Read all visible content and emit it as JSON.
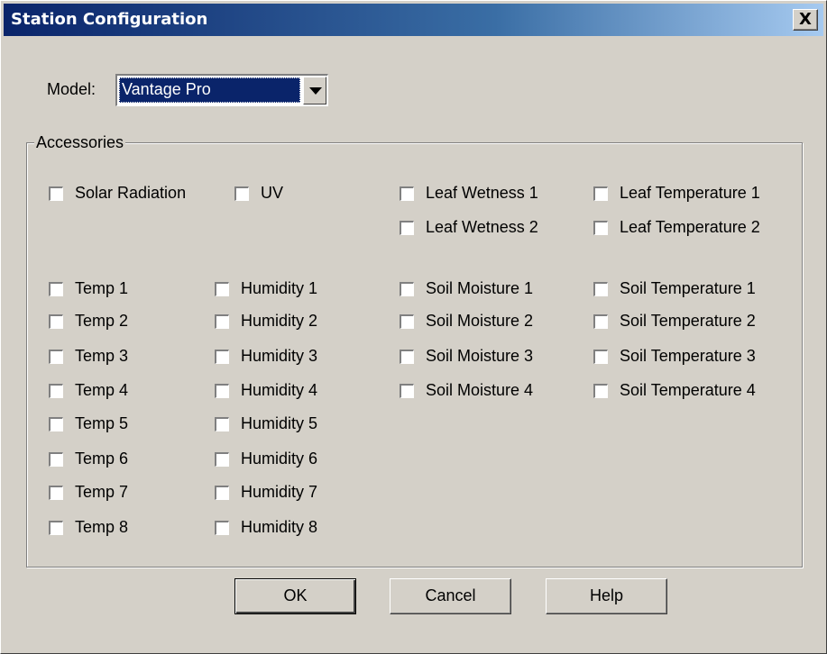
{
  "window": {
    "title": "Station Configuration",
    "close_label": "X"
  },
  "model": {
    "label": "Model:",
    "value": "Vantage Pro"
  },
  "accessories": {
    "group_label": "Accessories",
    "items": [
      {
        "id": "solar",
        "label": "Solar Radiation",
        "checked": false
      },
      {
        "id": "uv",
        "label": "UV",
        "checked": false
      },
      {
        "id": "leafwet1",
        "label": "Leaf Wetness 1",
        "checked": false
      },
      {
        "id": "leaftemp1",
        "label": "Leaf Temperature 1",
        "checked": false
      },
      {
        "id": "leafwet2",
        "label": "Leaf Wetness 2",
        "checked": false
      },
      {
        "id": "leaftemp2",
        "label": "Leaf Temperature 2",
        "checked": false
      },
      {
        "id": "temp1",
        "label": "Temp 1",
        "checked": false
      },
      {
        "id": "temp2",
        "label": "Temp 2",
        "checked": false
      },
      {
        "id": "temp3",
        "label": "Temp 3",
        "checked": false
      },
      {
        "id": "temp4",
        "label": "Temp 4",
        "checked": false
      },
      {
        "id": "temp5",
        "label": "Temp 5",
        "checked": false
      },
      {
        "id": "temp6",
        "label": "Temp 6",
        "checked": false
      },
      {
        "id": "temp7",
        "label": "Temp 7",
        "checked": false
      },
      {
        "id": "temp8",
        "label": "Temp 8",
        "checked": false
      },
      {
        "id": "hum1",
        "label": "Humidity 1",
        "checked": false
      },
      {
        "id": "hum2",
        "label": "Humidity 2",
        "checked": false
      },
      {
        "id": "hum3",
        "label": "Humidity 3",
        "checked": false
      },
      {
        "id": "hum4",
        "label": "Humidity 4",
        "checked": false
      },
      {
        "id": "hum5",
        "label": "Humidity 5",
        "checked": false
      },
      {
        "id": "hum6",
        "label": "Humidity 6",
        "checked": false
      },
      {
        "id": "hum7",
        "label": "Humidity 7",
        "checked": false
      },
      {
        "id": "hum8",
        "label": "Humidity 8",
        "checked": false
      },
      {
        "id": "soilm1",
        "label": "Soil Moisture 1",
        "checked": false
      },
      {
        "id": "soilm2",
        "label": "Soil Moisture 2",
        "checked": false
      },
      {
        "id": "soilm3",
        "label": "Soil Moisture 3",
        "checked": false
      },
      {
        "id": "soilm4",
        "label": "Soil Moisture 4",
        "checked": false
      },
      {
        "id": "soilt1",
        "label": "Soil Temperature 1",
        "checked": false
      },
      {
        "id": "soilt2",
        "label": "Soil Temperature 2",
        "checked": false
      },
      {
        "id": "soilt3",
        "label": "Soil Temperature 3",
        "checked": false
      },
      {
        "id": "soilt4",
        "label": "Soil Temperature 4",
        "checked": false
      }
    ]
  },
  "buttons": {
    "ok": "OK",
    "cancel": "Cancel",
    "help": "Help"
  },
  "colors": {
    "face": "#d4d0c8",
    "title_start": "#0a246a",
    "title_end": "#a6caf0",
    "selection": "#0a246a"
  }
}
